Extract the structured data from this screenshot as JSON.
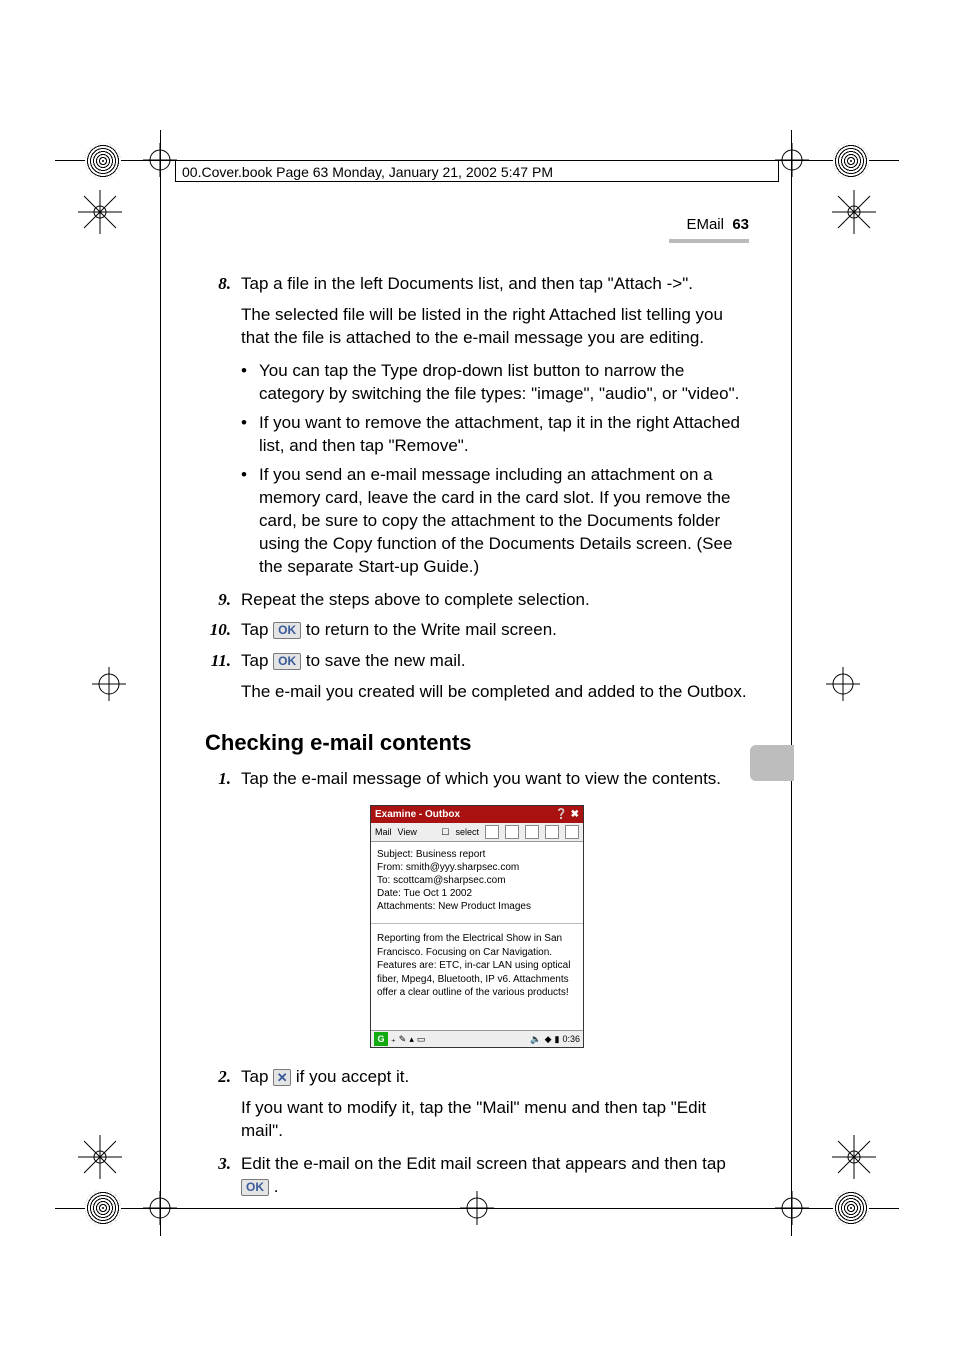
{
  "crop_header": "00.Cover.book  Page 63  Monday, January 21, 2002  5:47 PM",
  "runhead": {
    "section": "EMail",
    "page": "63"
  },
  "steps": {
    "s8": {
      "num": "8.",
      "text": "Tap a file in the left Documents list, and then tap \"Attach ->\"."
    },
    "s8b": "The selected file will be listed in the right Attached list telling you that the file is attached to the e-mail message you are editing.",
    "bul1": "You can tap the Type drop-down list button to narrow the category by switching the file types: \"image\", \"audio\", or \"video\".",
    "bul2": "If you want to remove the attachment, tap it in the right Attached list, and then tap \"Remove\".",
    "bul3": "If you send an e-mail message including an attachment on a memory card, leave the card in the card slot. If you remove the card, be sure to copy the attachment to the Documents folder using the Copy function of the Documents Details screen. (See the separate Start-up Guide.)",
    "s9": {
      "num": "9.",
      "text": "Repeat the steps above to complete selection."
    },
    "s10": {
      "num": "10.",
      "pre": "Tap ",
      "post": " to return to the Write mail screen."
    },
    "s11": {
      "num": "11.",
      "pre": "Tap ",
      "post": " to save the new mail."
    },
    "s11b": "The e-mail you created will be completed and added to the Outbox."
  },
  "section_heading": "Checking e-mail contents",
  "check": {
    "s1": {
      "num": "1.",
      "text": "Tap the e-mail message of which you want to view the contents."
    },
    "s2": {
      "num": "2.",
      "pre": "Tap ",
      "post": " if you accept it."
    },
    "s2b": "If you want to modify it, tap the \"Mail\" menu and then tap \"Edit mail\".",
    "s3": {
      "num": "3.",
      "pre": "Edit the e-mail on the Edit mail screen that appears and then tap ",
      "post": " ."
    }
  },
  "ok_label": "OK",
  "x_label": "✕",
  "screenshot": {
    "title": "Examine - Outbox",
    "menu_mail": "Mail",
    "menu_view": "View",
    "select": "select",
    "hdr_subject": "Subject: Business report",
    "hdr_from": "From:  smith@yyy.sharpsec.com",
    "hdr_to": "To: scottcam@sharpsec.com",
    "hdr_date": "Date: Tue Oct 1 2002",
    "hdr_attach": "Attachments: New Product Images",
    "body": "Reporting from the Electrical Show in San Francisco. Focusing on Car Navigation. Features are: ETC, in-car LAN using optical fiber, Mpeg4, Bluetooth, IP v6. Attachments offer a clear outline of the various products!",
    "time": "0:36"
  }
}
